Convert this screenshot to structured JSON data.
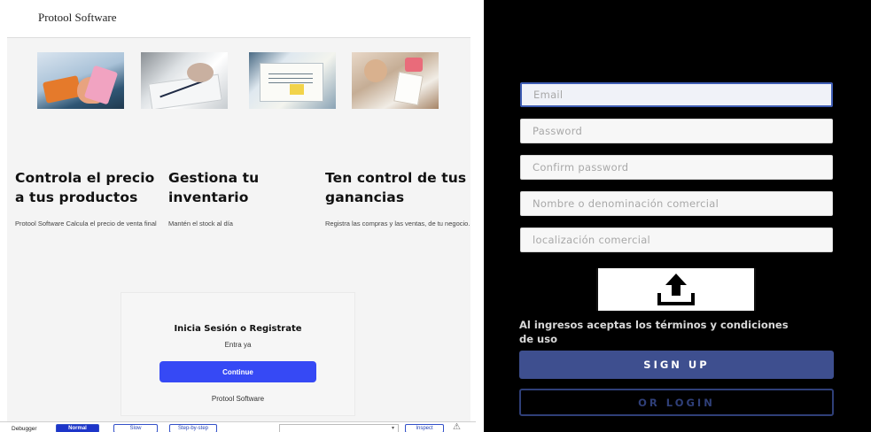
{
  "left_app": {
    "brand": "Protool Software",
    "images": [
      {
        "icon": "calculator-photo"
      },
      {
        "icon": "pen-on-paper-photo"
      },
      {
        "icon": "sticky-note-desk-photo"
      },
      {
        "icon": "phone-desk-photo"
      }
    ],
    "features": [
      {
        "title": "Controla el precio a tus productos",
        "desc": "Protool Software Calcula el precio de venta final"
      },
      {
        "title": "Gestiona tu inventario",
        "desc": "Mantén el stock al día"
      },
      {
        "title": "Ten control de tus ganancias",
        "desc": "Registra las compras y las ventas, de tu negocio."
      }
    ],
    "login_card": {
      "title": "Inicia Sesión o Registrate",
      "subtitle": "Entra ya",
      "button": "Continue",
      "footer": "Protool Software"
    },
    "debugger": {
      "label": "Debugger",
      "modes": [
        "Normal",
        "Slow",
        "Step-by-step"
      ],
      "active_mode": "Normal",
      "select_value": "",
      "inspect": "Inspect"
    }
  },
  "right_app": {
    "fields": {
      "email": "Email",
      "password": "Password",
      "confirm": "Confirm password",
      "business_name": "Nombre o denominación comercial",
      "location": "localización comercial"
    },
    "upload_icon": "upload-icon",
    "terms": "Al ingresos aceptas los términos y condiciones de uso",
    "signup_button": "SIGN UP",
    "login_button": "OR LOGIN"
  },
  "colors": {
    "primary_blue": "#3649f5",
    "signup_bg": "#3e4f8f",
    "login_border": "#2f3f78",
    "dark_bg": "#000000"
  }
}
